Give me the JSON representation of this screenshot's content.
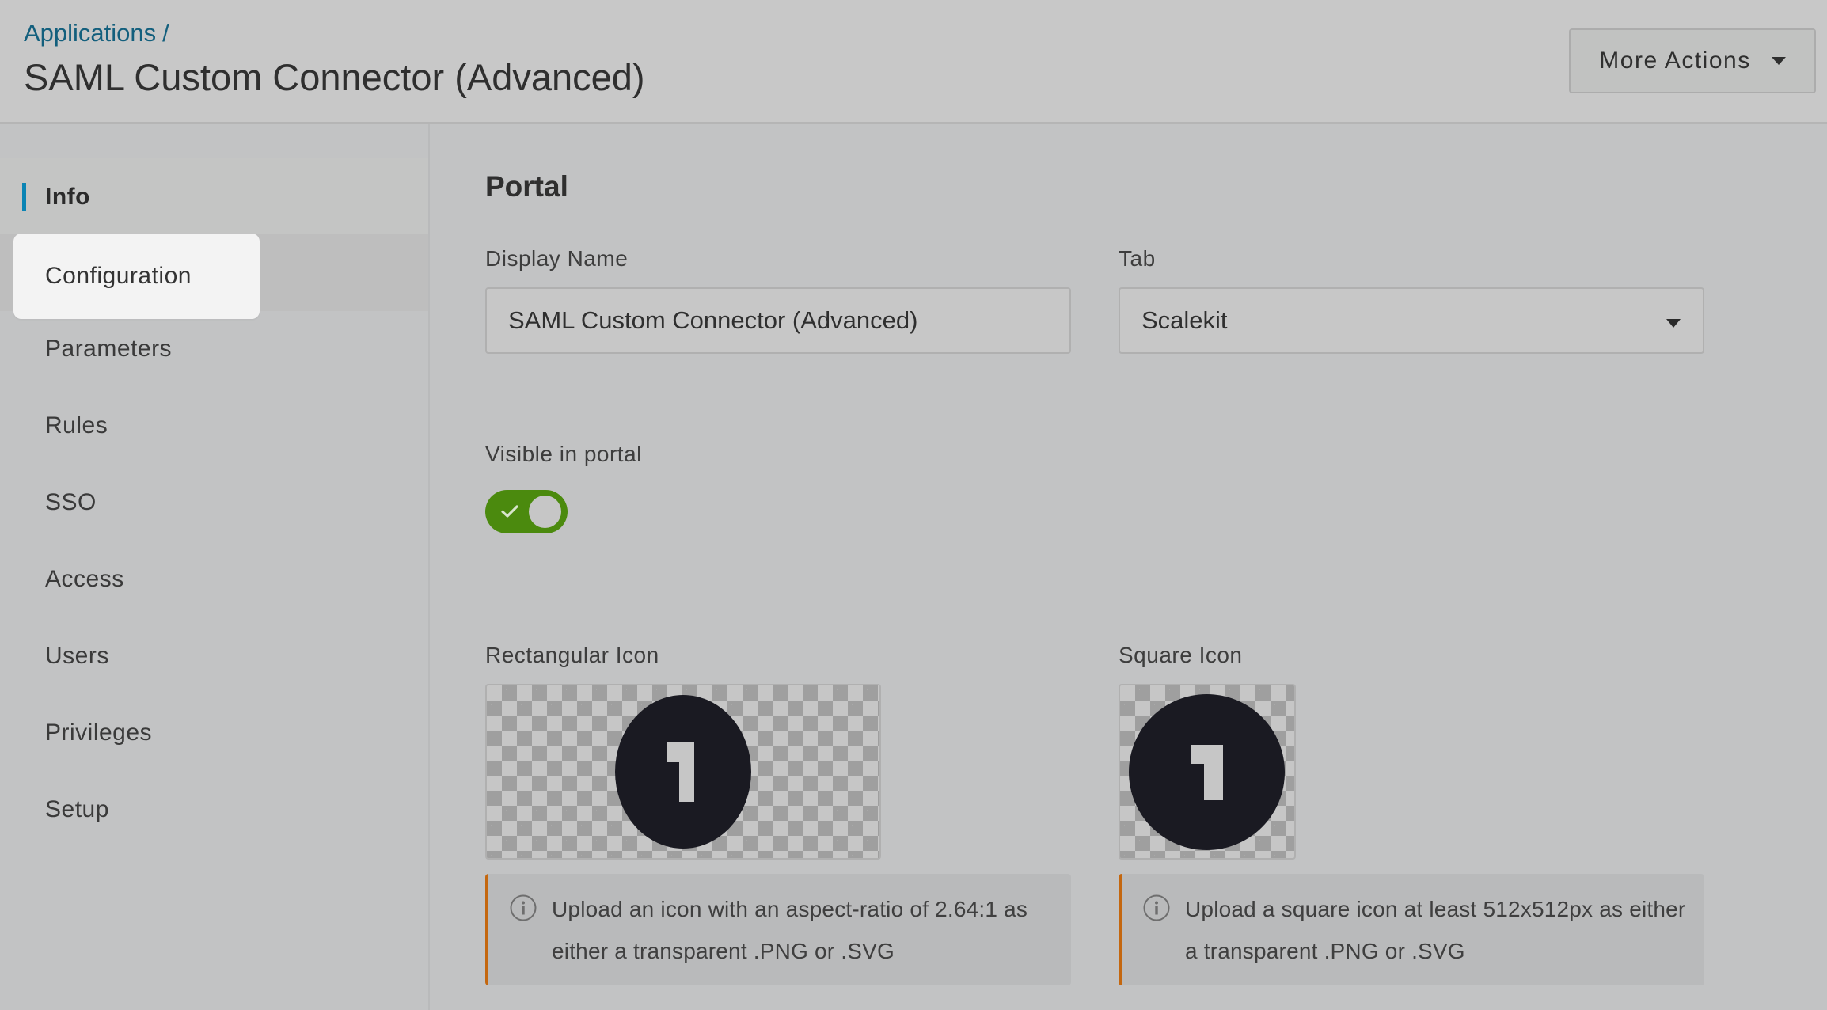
{
  "header": {
    "breadcrumb": {
      "parent": "Applications",
      "separator": "/"
    },
    "title": "SAML Custom Connector (Advanced)",
    "more_actions_label": "More Actions",
    "more_actions_icon": "caret-down-icon"
  },
  "sidebar": {
    "items": [
      {
        "label": "Info",
        "state": "active"
      },
      {
        "label": "Configuration",
        "state": "hover"
      },
      {
        "label": "Parameters"
      },
      {
        "label": "Rules"
      },
      {
        "label": "SSO"
      },
      {
        "label": "Access"
      },
      {
        "label": "Users"
      },
      {
        "label": "Privileges"
      },
      {
        "label": "Setup"
      }
    ],
    "active_accent_color": "#0a84b4"
  },
  "main": {
    "section_title": "Portal",
    "display_name": {
      "label": "Display Name",
      "value": "SAML Custom Connector (Advanced)"
    },
    "tab": {
      "label": "Tab",
      "selected": "Scalekit"
    },
    "visible_in_portal": {
      "label": "Visible in portal",
      "checked": true,
      "color": "#4b8a0e"
    },
    "rectangular_icon": {
      "label": "Rectangular Icon",
      "glyph": "1",
      "hint": "Upload an icon with an aspect-ratio of 2.64:1 as either a transparent .PNG or .SVG"
    },
    "square_icon": {
      "label": "Square Icon",
      "glyph": "1",
      "hint": "Upload a square icon at least 512x512px as either a transparent .PNG or .SVG"
    },
    "callout_accent_color": "#c4670f"
  }
}
